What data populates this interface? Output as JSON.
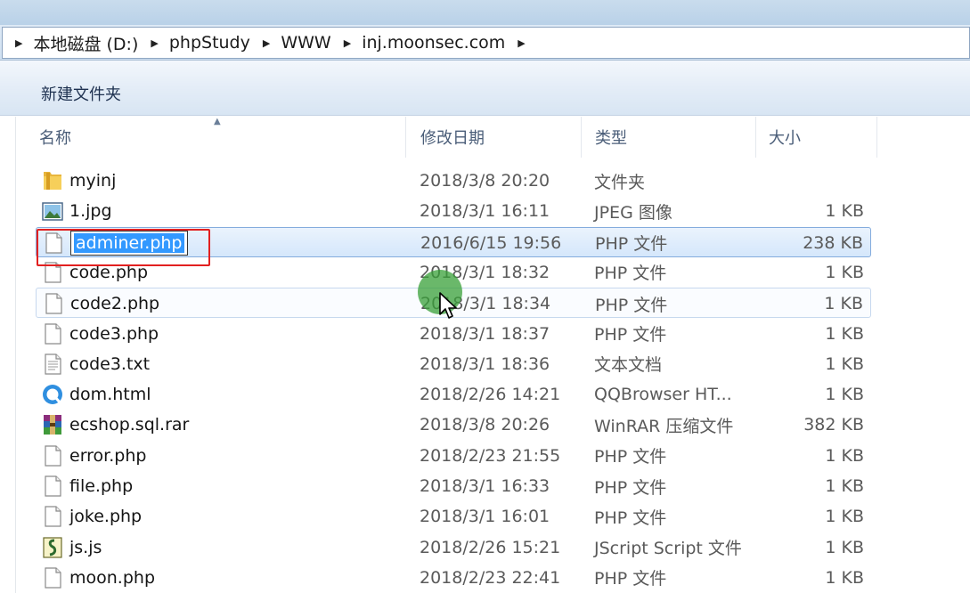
{
  "breadcrumb": [
    "本地磁盘 (D:)",
    "phpStudy",
    "WWW",
    "inj.moonsec.com"
  ],
  "toolbar": {
    "new_folder": "新建文件夹"
  },
  "columns": {
    "name": "名称",
    "date": "修改日期",
    "type": "类型",
    "size": "大小"
  },
  "files": [
    {
      "name": "myinj",
      "date": "2018/3/8 20:20",
      "type": "文件夹",
      "size": "",
      "icon": "folder-icon"
    },
    {
      "name": "1.jpg",
      "date": "2018/3/1 16:11",
      "type": "JPEG 图像",
      "size": "1 KB",
      "icon": "image-file-icon"
    },
    {
      "name": "adminer.php",
      "date": "2016/6/15 19:56",
      "type": "PHP 文件",
      "size": "238 KB",
      "icon": "blank-file-icon"
    },
    {
      "name": "code.php",
      "date": "2018/3/1 18:32",
      "type": "PHP 文件",
      "size": "1 KB",
      "icon": "blank-file-icon"
    },
    {
      "name": "code2.php",
      "date": "2018/3/1 18:34",
      "type": "PHP 文件",
      "size": "1 KB",
      "icon": "blank-file-icon"
    },
    {
      "name": "code3.php",
      "date": "2018/3/1 18:37",
      "type": "PHP 文件",
      "size": "1 KB",
      "icon": "blank-file-icon"
    },
    {
      "name": "code3.txt",
      "date": "2018/3/1 18:36",
      "type": "文本文档",
      "size": "1 KB",
      "icon": "text-file-icon"
    },
    {
      "name": "dom.html",
      "date": "2018/2/26 14:21",
      "type": "QQBrowser HT...",
      "size": "1 KB",
      "icon": "browser-file-icon"
    },
    {
      "name": "ecshop.sql.rar",
      "date": "2018/3/8 20:26",
      "type": "WinRAR 压缩文件",
      "size": "382 KB",
      "icon": "winrar-file-icon"
    },
    {
      "name": "error.php",
      "date": "2018/2/23 21:55",
      "type": "PHP 文件",
      "size": "1 KB",
      "icon": "blank-file-icon"
    },
    {
      "name": "file.php",
      "date": "2018/3/1 16:33",
      "type": "PHP 文件",
      "size": "1 KB",
      "icon": "blank-file-icon"
    },
    {
      "name": "joke.php",
      "date": "2018/3/1 16:01",
      "type": "PHP 文件",
      "size": "1 KB",
      "icon": "blank-file-icon"
    },
    {
      "name": "js.js",
      "date": "2018/2/26 15:21",
      "type": "JScript Script 文件",
      "size": "1 KB",
      "icon": "script-file-icon"
    },
    {
      "name": "moon.php",
      "date": "2018/2/23 22:41",
      "type": "PHP 文件",
      "size": "1 KB",
      "icon": "blank-file-icon"
    }
  ]
}
